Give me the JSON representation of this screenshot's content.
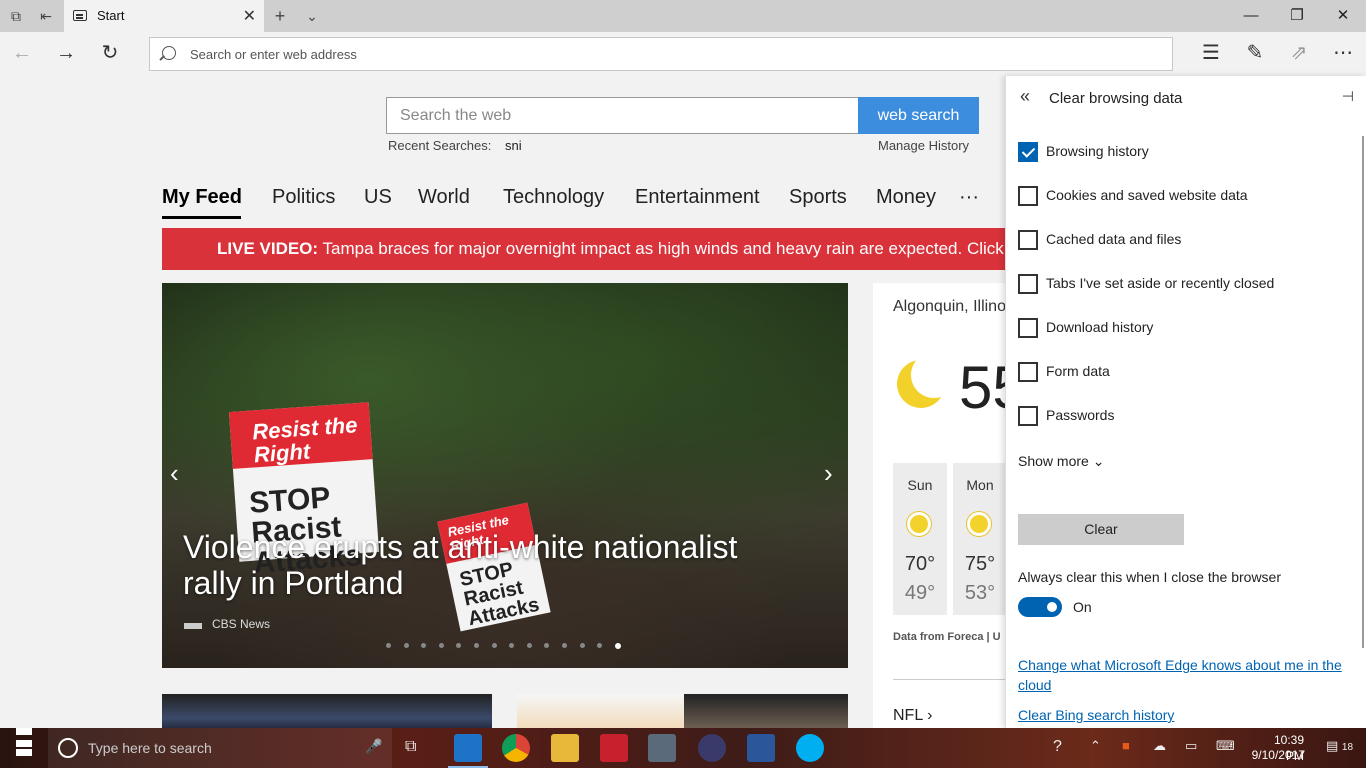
{
  "tab": {
    "title": "Start"
  },
  "address_bar": {
    "placeholder": "Search or enter web address"
  },
  "search": {
    "placeholder": "Search the web",
    "button": "web search",
    "recent_label": "Recent Searches:",
    "recent_value": "sni",
    "manage_history": "Manage History"
  },
  "feed_tabs": [
    "My Feed",
    "Politics",
    "US",
    "World",
    "Technology",
    "Entertainment",
    "Sports",
    "Money",
    "···"
  ],
  "live_banner": {
    "prefix": "LIVE VIDEO:",
    "text": " Tampa braces for major overnight impact as high winds and heavy rain are expected. Click to w"
  },
  "hero": {
    "title": "Violence erupts at anti-white nationalist rally in Portland",
    "source": "CBS News",
    "sign1_red": "Resist the Right",
    "sign1_black": "STOP Racist Attacks",
    "sign2_red": "Resist the Right",
    "sign2_black": "STOP Racist Attacks",
    "slide_count": 14,
    "active_slide": 13
  },
  "weather": {
    "location": "Algonquin, Illino",
    "temperature": "55",
    "forecast": [
      {
        "day": "Sun",
        "high": "70°",
        "low": "49°"
      },
      {
        "day": "Mon",
        "high": "75°",
        "low": "53°"
      }
    ],
    "source": "Data from Foreca | U",
    "nfl": "NFL"
  },
  "panel": {
    "title": "Clear browsing data",
    "options": [
      {
        "label": "Browsing history",
        "checked": true
      },
      {
        "label": "Cookies and saved website data",
        "checked": false
      },
      {
        "label": "Cached data and files",
        "checked": false
      },
      {
        "label": "Tabs I've set aside or recently closed",
        "checked": false
      },
      {
        "label": "Download history",
        "checked": false
      },
      {
        "label": "Form data",
        "checked": false
      },
      {
        "label": "Passwords",
        "checked": false
      }
    ],
    "show_more": "Show more",
    "clear_button": "Clear",
    "always_clear_label": "Always clear this when I close the browser",
    "toggle_state": "On",
    "link_cloud": "Change what Microsoft Edge knows about me in the cloud",
    "link_bing": "Clear Bing search history"
  },
  "taskbar": {
    "search_placeholder": "Type here to search",
    "time": "10:39 PM",
    "date": "9/10/2017",
    "notifications": "18"
  },
  "colors": {
    "accent": "#0063b1",
    "search_button": "#3c8ddd",
    "live_banner": "#d9323b"
  }
}
